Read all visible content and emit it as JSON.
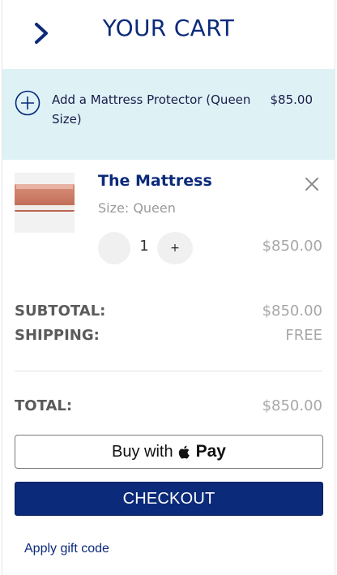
{
  "header": {
    "title": "YOUR CART"
  },
  "upsell": {
    "label": "Add a Mattress Protector (Queen Size)",
    "price": "$85.00"
  },
  "item": {
    "name": "The Mattress",
    "size": "Size: Queen",
    "quantity": "1",
    "plus_label": "+",
    "price": "$850.00"
  },
  "summary": {
    "subtotal_label": "SUBTOTAL:",
    "subtotal_value": "$850.00",
    "shipping_label": "SHIPPING:",
    "shipping_value": "FREE",
    "total_label": "TOTAL:",
    "total_value": "$850.00"
  },
  "buttons": {
    "applepay_prefix": "Buy with",
    "applepay_pay": "Pay",
    "checkout": "CHECKOUT",
    "gift_code": "Apply gift code"
  },
  "colors": {
    "brand": "#0b2a7a",
    "upsell_bg": "#def2f6",
    "muted": "#a7a7a7"
  },
  "icons": [
    "chevron-right-icon",
    "plus-circle-icon",
    "close-icon",
    "apple-logo-icon"
  ]
}
